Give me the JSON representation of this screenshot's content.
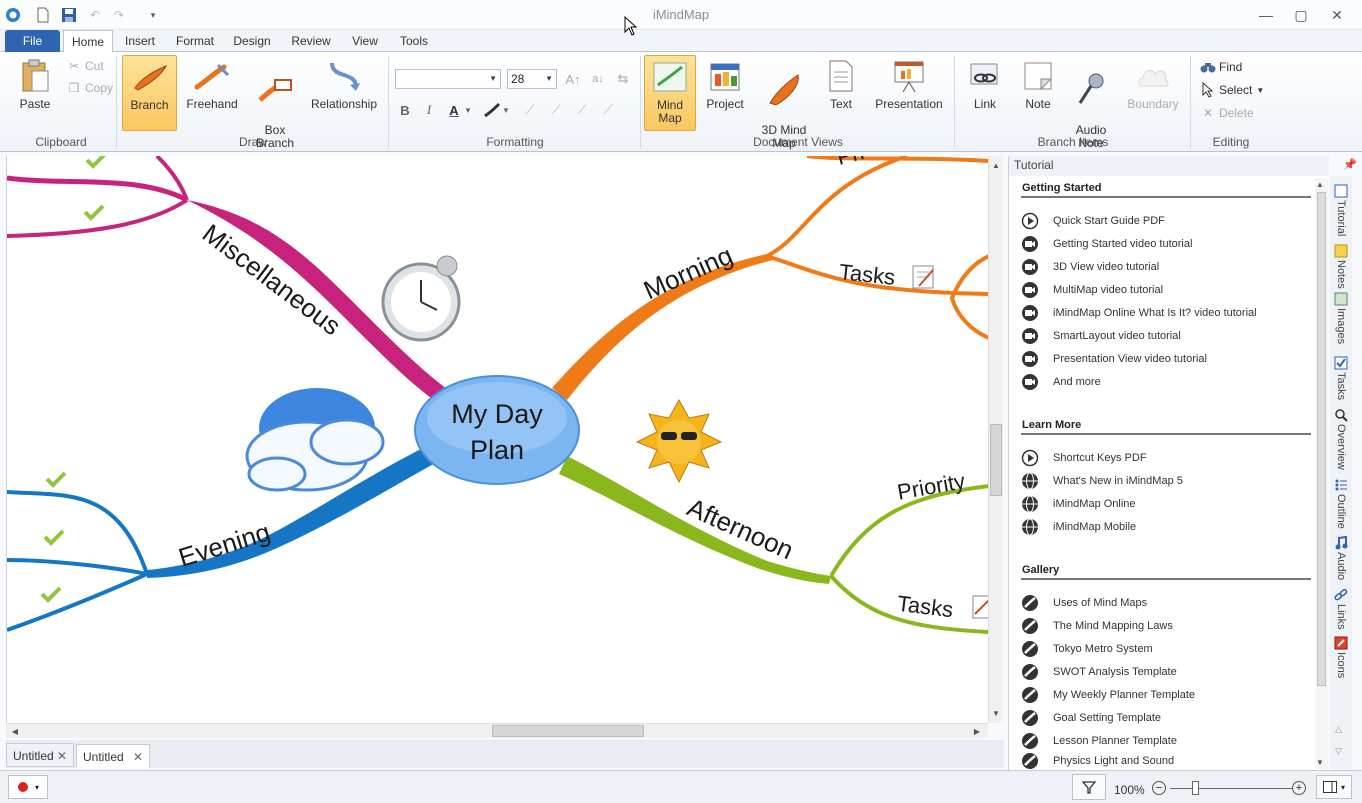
{
  "app": {
    "title": "iMindMap"
  },
  "window": {
    "minimize": "—",
    "maximize": "▢",
    "close": "✕"
  },
  "tabs": [
    "File",
    "Home",
    "Insert",
    "Format",
    "Design",
    "Review",
    "View",
    "Tools"
  ],
  "ribbon": {
    "clipboard": {
      "label": "Clipboard",
      "paste": "Paste",
      "cut": "Cut",
      "copy": "Copy"
    },
    "draw": {
      "label": "Draw",
      "branch": "Branch",
      "freehand": "Freehand",
      "box_branch": "Box\nBranch",
      "relationship": "Relationship"
    },
    "formatting": {
      "label": "Formatting",
      "font_name": "",
      "font_size": "28"
    },
    "document_views": {
      "label": "Document Views",
      "mind_map": "Mind Map",
      "project": "Project",
      "3d_mind_map": "3D Mind\nMap",
      "text": "Text",
      "presentation": "Presentation"
    },
    "branch_items": {
      "label": "Branch Items",
      "link": "Link",
      "note": "Note",
      "audio_note": "Audio\nNote",
      "boundary": "Boundary"
    },
    "editing": {
      "label": "Editing",
      "find": "Find",
      "select": "Select",
      "delete": "Delete"
    }
  },
  "mindmap": {
    "central": [
      "My Day",
      "Plan"
    ],
    "branches": [
      "Miscellaneous",
      "Morning",
      "Evening",
      "Afternoon"
    ],
    "sub_branches": [
      "Tasks",
      "Priority",
      "Tasks",
      "Pri"
    ]
  },
  "doc_tabs": [
    "Untitled",
    "Untitled"
  ],
  "panel": {
    "title": "Tutorial",
    "sections": [
      {
        "title": "Getting Started",
        "items": [
          {
            "label": "Quick Start Guide PDF",
            "icon": "play-icon"
          },
          {
            "label": "Getting Started video tutorial",
            "icon": "video-icon"
          },
          {
            "label": "3D View video tutorial",
            "icon": "video-icon"
          },
          {
            "label": "MultiMap video tutorial",
            "icon": "video-icon"
          },
          {
            "label": "iMindMap Online What Is It? video tutorial",
            "icon": "video-icon"
          },
          {
            "label": "SmartLayout video tutorial",
            "icon": "video-icon"
          },
          {
            "label": "Presentation View video tutorial",
            "icon": "video-icon"
          },
          {
            "label": "And more",
            "icon": "video-icon"
          }
        ]
      },
      {
        "title": "Learn More",
        "items": [
          {
            "label": "Shortcut Keys PDF",
            "icon": "play-icon"
          },
          {
            "label": "What's New in iMindMap 5",
            "icon": "globe-icon"
          },
          {
            "label": "iMindMap Online",
            "icon": "globe-icon"
          },
          {
            "label": "iMindMap Mobile",
            "icon": "globe-icon"
          }
        ]
      },
      {
        "title": "Gallery",
        "items": [
          {
            "label": "Uses of Mind Maps",
            "icon": "brush-icon"
          },
          {
            "label": "The Mind Mapping Laws",
            "icon": "brush-icon"
          },
          {
            "label": "Tokyo Metro System",
            "icon": "brush-icon"
          },
          {
            "label": "SWOT Analysis Template",
            "icon": "brush-icon"
          },
          {
            "label": "My Weekly Planner Template",
            "icon": "brush-icon"
          },
          {
            "label": "Goal Setting Template",
            "icon": "brush-icon"
          },
          {
            "label": "Lesson Planner Template",
            "icon": "brush-icon"
          },
          {
            "label": "Physics Light and Sound",
            "icon": "brush-icon"
          }
        ]
      }
    ]
  },
  "vertical_tabs": [
    "Tutorial",
    "Notes",
    "Images",
    "Tasks",
    "Overview",
    "Outline",
    "Audio",
    "Links",
    "Icons"
  ],
  "status": {
    "zoom": "100%"
  }
}
